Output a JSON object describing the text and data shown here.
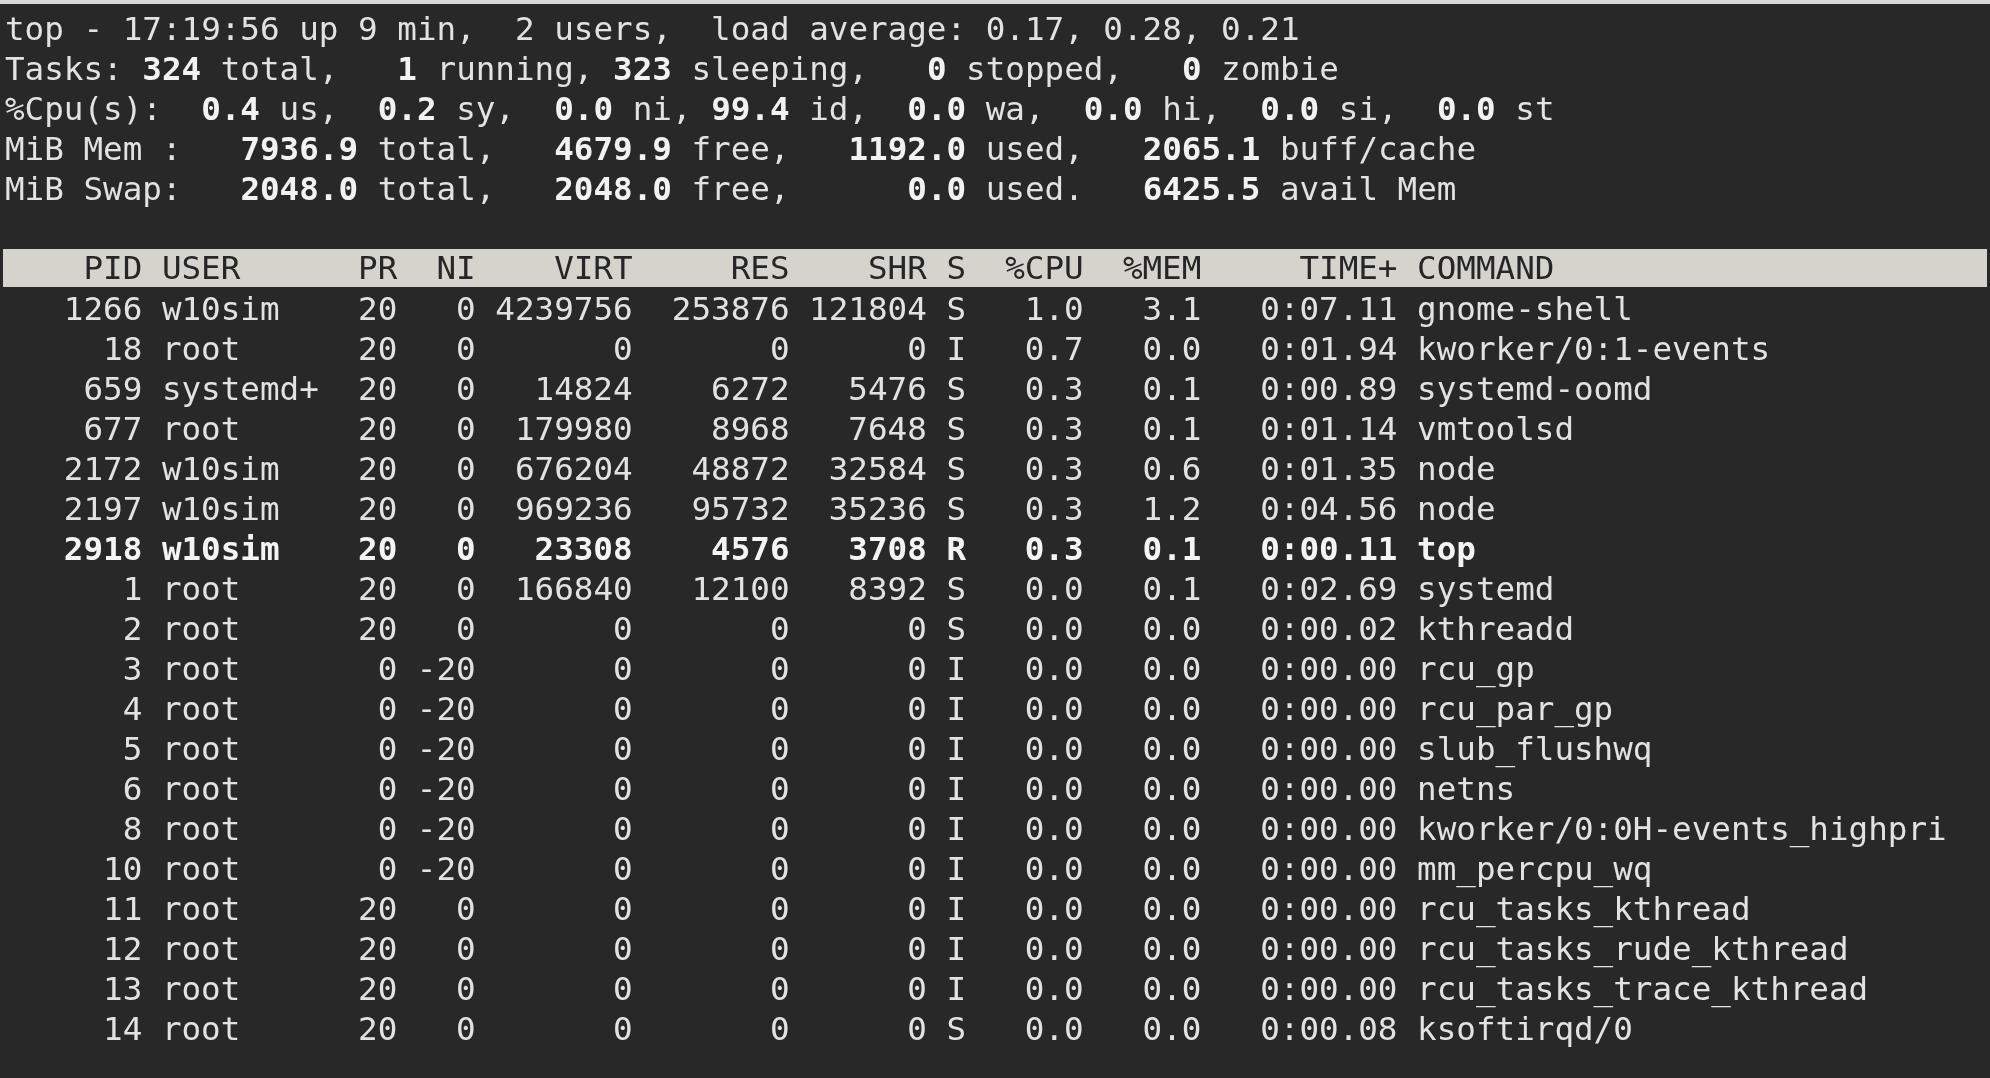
{
  "summary": [
    "top - 17:19:56 up 9 min,  2 users,  load average: 0.17, 0.28, 0.21",
    "Tasks: **324** total,   **1** running, **323** sleeping,   **0** stopped,   **0** zombie",
    "%Cpu(s):  **0.4** us,  **0.2** sy,  **0.0** ni, **99.4** id,  **0.0** wa,  **0.0** hi,  **0.0** si,  **0.0** st",
    "MiB Mem :   **7936.9** total,   **4679.9** free,   **1192.0** used,   **2065.1** buff/cache",
    "MiB Swap:   **2048.0** total,   **2048.0** free,      **0.0** used.   **6425.5** avail Mem"
  ],
  "table": {
    "columns": [
      "PID",
      "USER",
      "PR",
      "NI",
      "VIRT",
      "RES",
      "SHR",
      "S",
      "%CPU",
      "%MEM",
      "TIME+",
      "COMMAND"
    ],
    "rows": [
      {
        "bold": false,
        "cells": [
          "1266",
          "w10sim",
          "20",
          "0",
          "4239756",
          "253876",
          "121804",
          "S",
          "1.0",
          "3.1",
          "0:07.11",
          "gnome-shell"
        ]
      },
      {
        "bold": false,
        "cells": [
          "18",
          "root",
          "20",
          "0",
          "0",
          "0",
          "0",
          "I",
          "0.7",
          "0.0",
          "0:01.94",
          "kworker/0:1-events"
        ]
      },
      {
        "bold": false,
        "cells": [
          "659",
          "systemd+",
          "20",
          "0",
          "14824",
          "6272",
          "5476",
          "S",
          "0.3",
          "0.1",
          "0:00.89",
          "systemd-oomd"
        ]
      },
      {
        "bold": false,
        "cells": [
          "677",
          "root",
          "20",
          "0",
          "179980",
          "8968",
          "7648",
          "S",
          "0.3",
          "0.1",
          "0:01.14",
          "vmtoolsd"
        ]
      },
      {
        "bold": false,
        "cells": [
          "2172",
          "w10sim",
          "20",
          "0",
          "676204",
          "48872",
          "32584",
          "S",
          "0.3",
          "0.6",
          "0:01.35",
          "node"
        ]
      },
      {
        "bold": false,
        "cells": [
          "2197",
          "w10sim",
          "20",
          "0",
          "969236",
          "95732",
          "35236",
          "S",
          "0.3",
          "1.2",
          "0:04.56",
          "node"
        ]
      },
      {
        "bold": true,
        "cells": [
          "2918",
          "w10sim",
          "20",
          "0",
          "23308",
          "4576",
          "3708",
          "R",
          "0.3",
          "0.1",
          "0:00.11",
          "top"
        ]
      },
      {
        "bold": false,
        "cells": [
          "1",
          "root",
          "20",
          "0",
          "166840",
          "12100",
          "8392",
          "S",
          "0.0",
          "0.1",
          "0:02.69",
          "systemd"
        ]
      },
      {
        "bold": false,
        "cells": [
          "2",
          "root",
          "20",
          "0",
          "0",
          "0",
          "0",
          "S",
          "0.0",
          "0.0",
          "0:00.02",
          "kthreadd"
        ]
      },
      {
        "bold": false,
        "cells": [
          "3",
          "root",
          "0",
          "-20",
          "0",
          "0",
          "0",
          "I",
          "0.0",
          "0.0",
          "0:00.00",
          "rcu_gp"
        ]
      },
      {
        "bold": false,
        "cells": [
          "4",
          "root",
          "0",
          "-20",
          "0",
          "0",
          "0",
          "I",
          "0.0",
          "0.0",
          "0:00.00",
          "rcu_par_gp"
        ]
      },
      {
        "bold": false,
        "cells": [
          "5",
          "root",
          "0",
          "-20",
          "0",
          "0",
          "0",
          "I",
          "0.0",
          "0.0",
          "0:00.00",
          "slub_flushwq"
        ]
      },
      {
        "bold": false,
        "cells": [
          "6",
          "root",
          "0",
          "-20",
          "0",
          "0",
          "0",
          "I",
          "0.0",
          "0.0",
          "0:00.00",
          "netns"
        ]
      },
      {
        "bold": false,
        "cells": [
          "8",
          "root",
          "0",
          "-20",
          "0",
          "0",
          "0",
          "I",
          "0.0",
          "0.0",
          "0:00.00",
          "kworker/0:0H-events_highpri"
        ]
      },
      {
        "bold": false,
        "cells": [
          "10",
          "root",
          "0",
          "-20",
          "0",
          "0",
          "0",
          "I",
          "0.0",
          "0.0",
          "0:00.00",
          "mm_percpu_wq"
        ]
      },
      {
        "bold": false,
        "cells": [
          "11",
          "root",
          "20",
          "0",
          "0",
          "0",
          "0",
          "I",
          "0.0",
          "0.0",
          "0:00.00",
          "rcu_tasks_kthread"
        ]
      },
      {
        "bold": false,
        "cells": [
          "12",
          "root",
          "20",
          "0",
          "0",
          "0",
          "0",
          "I",
          "0.0",
          "0.0",
          "0:00.00",
          "rcu_tasks_rude_kthread"
        ]
      },
      {
        "bold": false,
        "cells": [
          "13",
          "root",
          "20",
          "0",
          "0",
          "0",
          "0",
          "I",
          "0.0",
          "0.0",
          "0:00.00",
          "rcu_tasks_trace_kthread"
        ]
      },
      {
        "bold": false,
        "cells": [
          "14",
          "root",
          "20",
          "0",
          "0",
          "0",
          "0",
          "S",
          "0.0",
          "0.0",
          "0:00.08",
          "ksoftirqd/0"
        ]
      }
    ]
  }
}
